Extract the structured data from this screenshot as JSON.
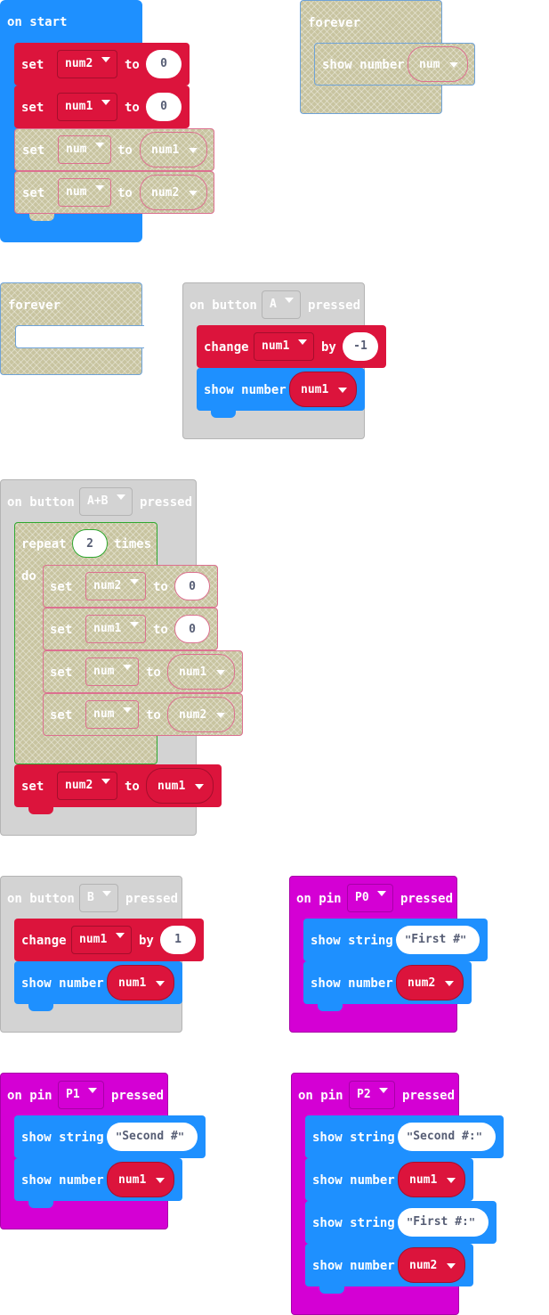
{
  "colors": {
    "events": "#1e90ff",
    "variables": "#dc143c",
    "basic": "#1e90ff",
    "input": "#d3d3d3",
    "pins": "#d400d4",
    "loops": "#00aa00",
    "disabled": "#c8c4a0"
  },
  "on_start": {
    "title": "on start",
    "set1": {
      "set": "set",
      "var": "num2",
      "to": "to",
      "value": "0"
    },
    "set2": {
      "set": "set",
      "var": "num1",
      "to": "to",
      "value": "0"
    },
    "set3": {
      "set": "set",
      "var": "num",
      "to": "to",
      "value": "num1"
    },
    "set4": {
      "set": "set",
      "var": "num",
      "to": "to",
      "value": "num2"
    }
  },
  "forever1": {
    "title": "forever",
    "show": {
      "label": "show number",
      "value": "num"
    }
  },
  "forever2": {
    "title": "forever"
  },
  "button_a": {
    "on": "on button",
    "button": "A",
    "pressed": "pressed",
    "change": {
      "label": "change",
      "var": "num1",
      "by": "by",
      "value": "-1"
    },
    "show": {
      "label": "show number",
      "value": "num1"
    }
  },
  "button_ab": {
    "on": "on button",
    "button": "A+B",
    "pressed": "pressed",
    "repeat": {
      "label": "repeat",
      "count": "2",
      "times": "times",
      "do": "do"
    },
    "set1": {
      "set": "set",
      "var": "num2",
      "to": "to",
      "value": "0"
    },
    "set2": {
      "set": "set",
      "var": "num1",
      "to": "to",
      "value": "0"
    },
    "set3": {
      "set": "set",
      "var": "num",
      "to": "to",
      "value": "num1"
    },
    "set4": {
      "set": "set",
      "var": "num",
      "to": "to",
      "value": "num2"
    },
    "set5": {
      "set": "set",
      "var": "num2",
      "to": "to",
      "value": "num1"
    }
  },
  "button_b": {
    "on": "on button",
    "button": "B",
    "pressed": "pressed",
    "change": {
      "label": "change",
      "var": "num1",
      "by": "by",
      "value": "1"
    },
    "show": {
      "label": "show number",
      "value": "num1"
    }
  },
  "pin_p0": {
    "on": "on pin",
    "pin": "P0",
    "pressed": "pressed",
    "show_string": {
      "label": "show string",
      "value": "First #"
    },
    "show_number": {
      "label": "show number",
      "value": "num2"
    }
  },
  "pin_p1": {
    "on": "on pin",
    "pin": "P1",
    "pressed": "pressed",
    "show_string": {
      "label": "show string",
      "value": "Second #"
    },
    "show_number": {
      "label": "show number",
      "value": "num1"
    }
  },
  "pin_p2": {
    "on": "on pin",
    "pin": "P2",
    "pressed": "pressed",
    "show_string1": {
      "label": "show string",
      "value": "Second #:"
    },
    "show_number1": {
      "label": "show number",
      "value": "num1"
    },
    "show_string2": {
      "label": "show string",
      "value": "First #:"
    },
    "show_number2": {
      "label": "show number",
      "value": "num2"
    }
  }
}
